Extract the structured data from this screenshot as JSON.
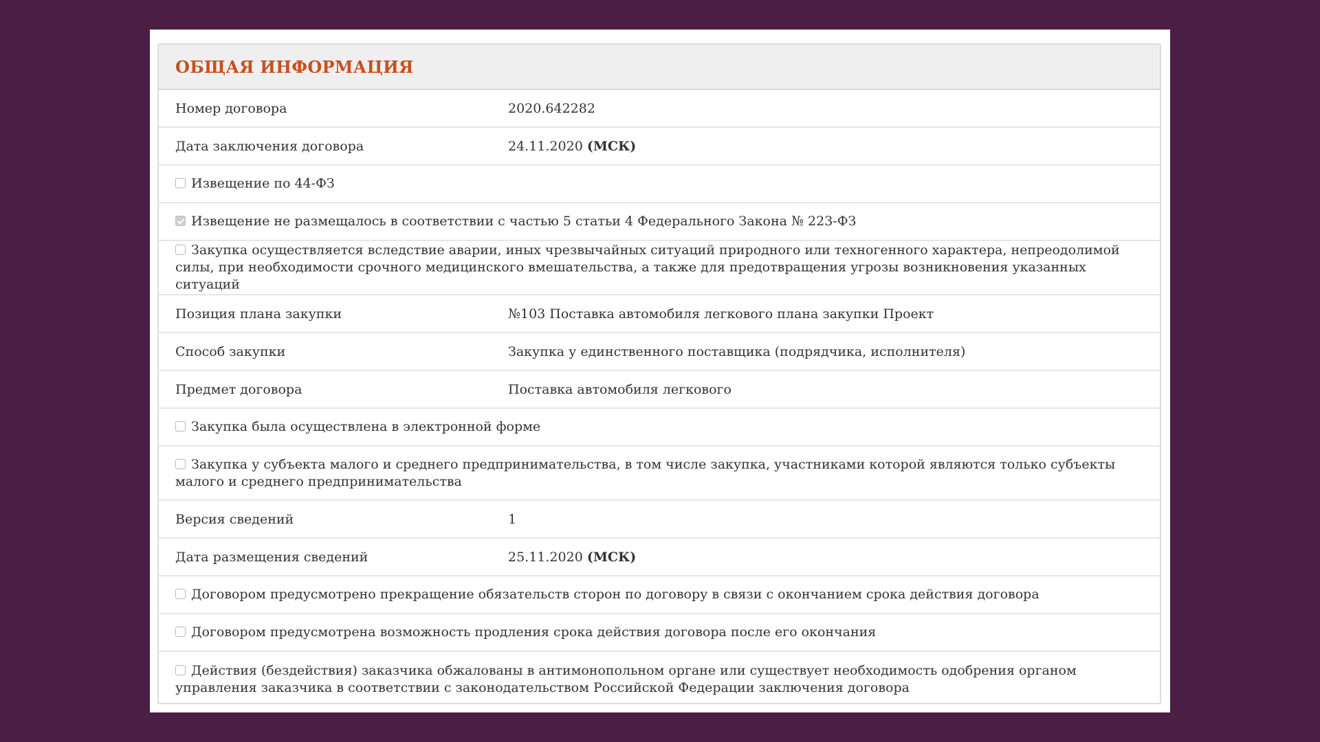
{
  "panel": {
    "title": "ОБЩАЯ ИНФОРМАЦИЯ"
  },
  "rows": {
    "contract_number": {
      "label": "Номер договора",
      "value": "2020.642282"
    },
    "contract_date": {
      "label": "Дата заключения договора",
      "value": "24.11.2020",
      "tz": "(МСК)"
    },
    "notice_44fz": {
      "label": "Извещение по 44-ФЗ",
      "checked": false
    },
    "notice_not_posted": {
      "label": "Извещение не размещалось в соответствии с частью 5 статьи 4 Федерального Закона № 223-ФЗ",
      "checked": true
    },
    "emergency": {
      "label": "Закупка осуществляется вследствие аварии, иных чрезвычайных ситуаций природного или техногенного характера, непреодолимой силы, при необходимости срочного медицинского вмешательства, а также для предотвращения угрозы возникновения указанных ситуаций",
      "checked": false
    },
    "plan_position": {
      "label": "Позиция плана закупки",
      "value": "№103 Поставка автомобиля легкового плана закупки Проект"
    },
    "method": {
      "label": "Способ закупки",
      "value": "Закупка у единственного поставщика (подрядчика, исполнителя)"
    },
    "subject": {
      "label": "Предмет договора",
      "value": "Поставка автомобиля легкового"
    },
    "electronic": {
      "label": "Закупка была осуществлена в электронной форме",
      "checked": false
    },
    "sme": {
      "label": "Закупка у субъекта малого и среднего предпринимательства, в том числе закупка, участниками которой являются только субъекты малого и среднего предпринимательства",
      "checked": false
    },
    "version": {
      "label": "Версия сведений",
      "value": "1"
    },
    "posting_date": {
      "label": "Дата размещения сведений",
      "value": "25.11.2020",
      "tz": "(МСК)"
    },
    "termination": {
      "label": "Договором предусмотрено прекращение обязательств сторон по договору в связи с окончанием срока действия договора",
      "checked": false
    },
    "extension": {
      "label": "Договором предусмотрена возможность продления срока действия договора после его окончания",
      "checked": false
    },
    "appeal": {
      "label": "Действия (бездействия) заказчика обжалованы в антимонопольном органе или существует необходимость одобрения органом управления заказчика в соответствии с законодательством Российской Федерации заключения договора",
      "checked": false
    }
  }
}
